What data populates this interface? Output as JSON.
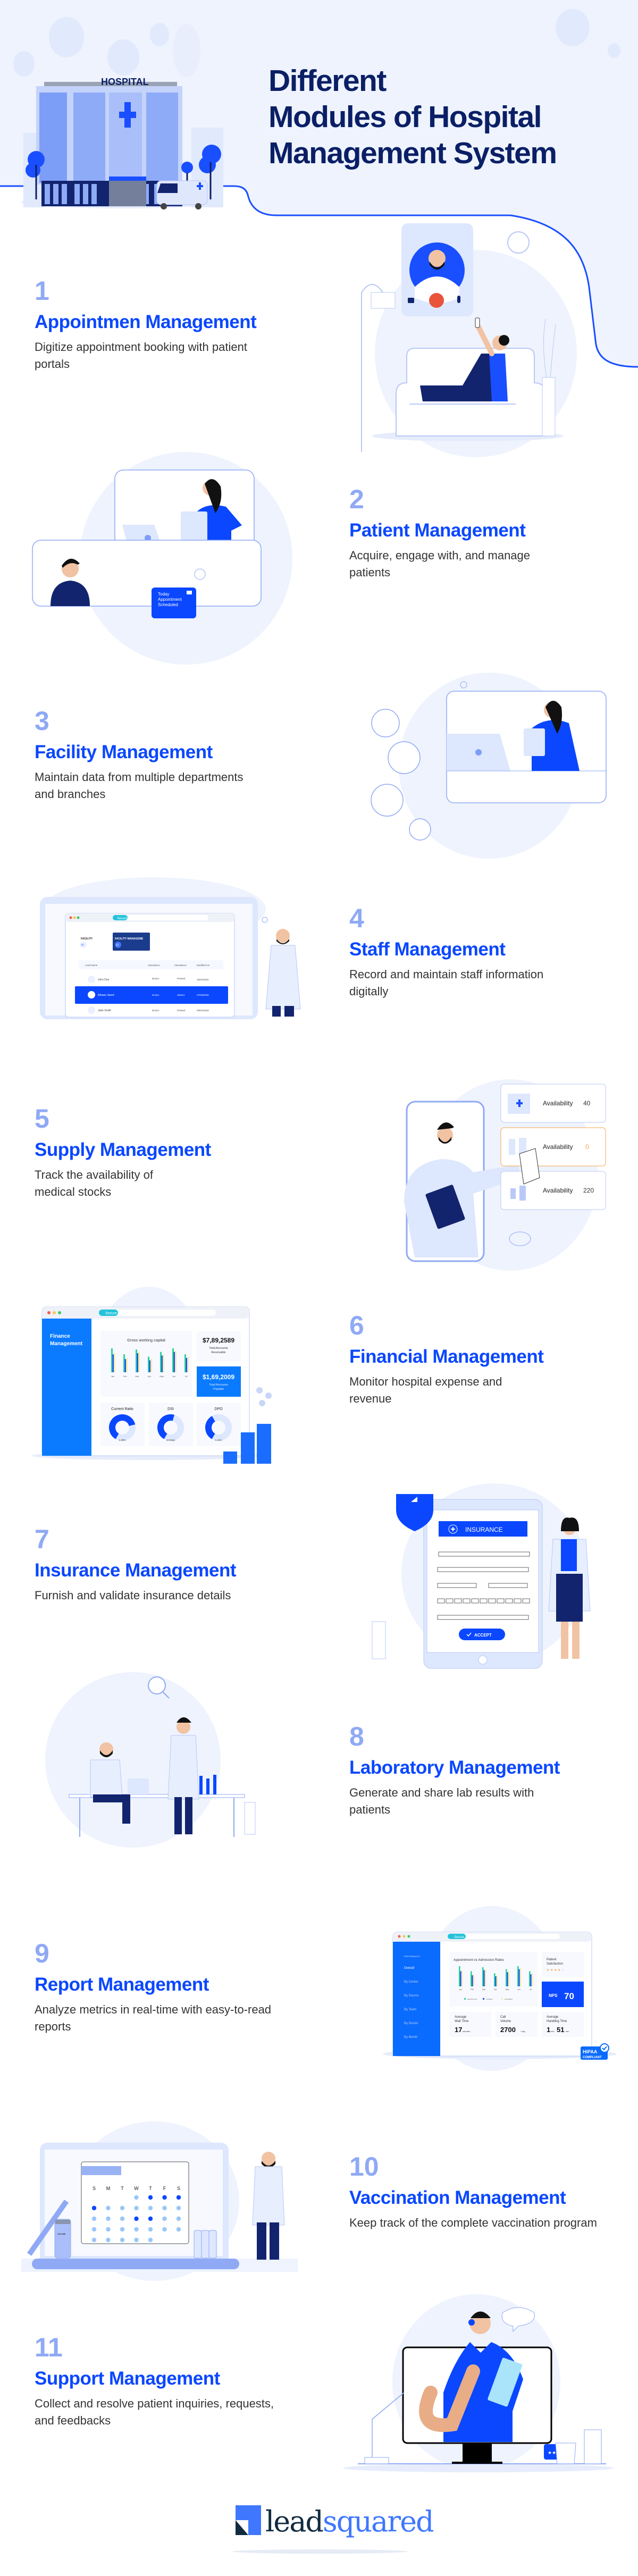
{
  "header": {
    "title_lines": [
      "Different",
      "Modules of Hospital",
      "Management System"
    ],
    "hospital_sign": "HOSPITAL"
  },
  "modules": [
    {
      "number": "1",
      "title": "Appointmen Management",
      "description": "Digitize appointment booking with patient portals"
    },
    {
      "number": "2",
      "title": "Patient Management",
      "description": "Acquire, engage with, and manage patients"
    },
    {
      "number": "3",
      "title": "Facility Management",
      "description": "Maintain data from multiple departments and branches"
    },
    {
      "number": "4",
      "title": "Staff Management",
      "description": "Record and maintain staff information digitally"
    },
    {
      "number": "5",
      "title": "Supply Management",
      "description": "Track the availability of medical stocks"
    },
    {
      "number": "6",
      "title": "Financial Management",
      "description": "Monitor hospital expense and revenue"
    },
    {
      "number": "7",
      "title": "Insurance Management",
      "description": "Furnish and validate insurance details"
    },
    {
      "number": "8",
      "title": "Laboratory Management",
      "description": "Generate and share lab results with patients"
    },
    {
      "number": "9",
      "title": "Report Management",
      "description": "Analyze metrics in real-time with easy-to-read reports"
    },
    {
      "number": "10",
      "title": "Vaccination Management",
      "description": "Keep track of the complete vaccination program"
    },
    {
      "number": "11",
      "title": "Support Management",
      "description": "Collect and resolve patient inquiries, requests, and feedbacks"
    }
  ],
  "illustrations": {
    "patient": {
      "notification_lines": [
        "Today",
        "Appointment",
        "Scheduled"
      ]
    },
    "staff": {
      "secure": "Secure",
      "facility_label": "FACILITY",
      "facility_count": "24",
      "tab_label": "FACILITY MANAGEME",
      "tab_count": "31",
      "columns": [
        "Lead Name",
        "Attendance",
        "Attendance",
        "Modified On"
      ],
      "rows": [
        {
          "name": "John Doe",
          "role": "Doctor",
          "status": "Present",
          "date": "15/11/2019"
        },
        {
          "name": "Arbaaz Javed",
          "role": "Doctor",
          "status": "Absent",
          "date": "27/09/2018"
        },
        {
          "name": "Jade Smith",
          "role": "Doctor",
          "status": "Present",
          "date": "03/01/2019"
        }
      ]
    },
    "supply": {
      "items": [
        {
          "label": "Availability",
          "value": "40"
        },
        {
          "label": "Availability",
          "value": "0"
        },
        {
          "label": "Availability",
          "value": "220"
        }
      ]
    },
    "finance": {
      "secure": "Secure",
      "sidebar_title_lines": [
        "Finance",
        "Management"
      ],
      "chart_title": "Gross working capital",
      "months": [
        "Jan",
        "Feb",
        "Mar",
        "Apr",
        "May",
        "Jun",
        "Jul"
      ],
      "receivable_value": "$7,89,2589",
      "receivable_label_lines": [
        "Total Accounts",
        "Receivable"
      ],
      "payable_value": "$1,69,2009",
      "payable_label_lines": [
        "Total Accounts",
        "Payable"
      ],
      "gauges": [
        {
          "title": "Current Ratio",
          "value": "1.48%"
        },
        {
          "title": "DSI",
          "value": "12 Days"
        },
        {
          "title": "DPO",
          "value": "1.41%"
        }
      ]
    },
    "insurance": {
      "title": "INSURANCE",
      "accept": "ACCEPT"
    },
    "report": {
      "secure": "Secure",
      "sidebar_heading": "PERFORMANCES",
      "sidebar_items": [
        "Overall",
        "By Center",
        "By Source",
        "By Team",
        "By Doctor",
        "By Month"
      ],
      "chart_title": "Appointment vs Admission Rates",
      "months": [
        "Jan",
        "Feb",
        "Mar",
        "Apr",
        "May",
        "Jun",
        "Jul"
      ],
      "legend": [
        "Appointments",
        "In-Patient",
        "Out-Patient"
      ],
      "satisfaction_lines": [
        "Patient",
        "Satisfaction"
      ],
      "stars_filled": 4,
      "stars_total": 5,
      "nps_label": "NPS",
      "nps_value": "70",
      "wait": {
        "lines": [
          "Average",
          "Wait Time"
        ],
        "value": "17",
        "unit": "minutes"
      },
      "calls": {
        "lines": [
          "Call",
          "Volume"
        ],
        "value": "2700",
        "unit": "/ day"
      },
      "handling": {
        "lines": [
          "Average",
          "Handling Time"
        ],
        "value": "1",
        "unit": "min",
        "value2": "51",
        "unit2": "sec"
      },
      "badge_lines": [
        "HIPAA",
        "COMPLIANT"
      ]
    },
    "vaccination": {
      "weekdays": [
        "S",
        "M",
        "T",
        "W",
        "T",
        "F",
        "S"
      ],
      "vial_label": "VACCINE"
    }
  },
  "footer": {
    "logo_part1": "lead",
    "logo_part2": "squared"
  },
  "colors": {
    "accent_blue": "#0a47ff",
    "navy": "#0b1f66",
    "number_blue": "#8fa9f5",
    "light_bg": "#eef3fd",
    "pale_blue": "#dde7fd",
    "alert_orange": "#f7a44a",
    "logo_blue": "#3f77ff"
  }
}
